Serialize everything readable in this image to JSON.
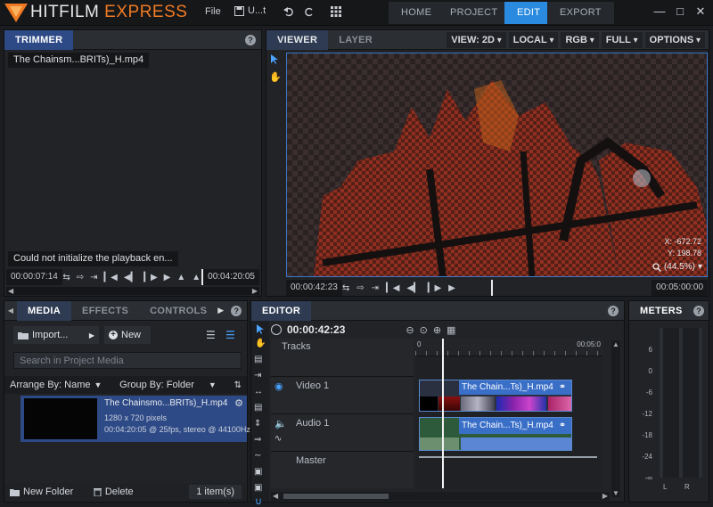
{
  "app": {
    "brand_main": "HITFILM",
    "brand_accent": "EXPRESS"
  },
  "menu": {
    "file": "File",
    "undo_label": "U...t"
  },
  "nav": {
    "tabs": [
      "HOME",
      "PROJECT",
      "EDIT",
      "EXPORT"
    ],
    "active": "EDIT"
  },
  "trimmer": {
    "tab": "TRIMMER",
    "file_label": "The Chainsm...BRITs)_H.mp4",
    "error_message": "Could not initialize the playback en...",
    "time_current": "00:00:07:14",
    "time_end": "00:04:20:05"
  },
  "viewer": {
    "tabs": [
      "VIEWER",
      "LAYER"
    ],
    "dropdowns": [
      "VIEW: 2D",
      "LOCAL",
      "RGB",
      "FULL",
      "OPTIONS"
    ],
    "coord_x_label": "X:",
    "coord_x": "-672.72",
    "coord_y_label": "Y:",
    "coord_y": "198.78",
    "zoom": "(44.5%)",
    "time_current": "00:00:42:23",
    "time_end": "00:05:00:00"
  },
  "media": {
    "tabs": [
      "MEDIA",
      "EFFECTS",
      "CONTROLS"
    ],
    "import_label": "Import...",
    "new_label": "New",
    "search_placeholder": "Search in Project Media",
    "arrange_label": "Arrange By: Name",
    "group_label": "Group By: Folder",
    "item": {
      "name": "The Chainsmo...BRITs)_H.mp4",
      "resolution": "1280 x 720 pixels",
      "details": "00:04:20:05 @ 25fps, stereo @ 44100Hz"
    },
    "new_folder_label": "New Folder",
    "delete_label": "Delete",
    "count": "1 item(s)"
  },
  "editor": {
    "tab": "EDITOR",
    "timecode": "00:00:42:23",
    "tracks_label": "Tracks",
    "ruler_start": "0",
    "ruler_mark": "00:05:0",
    "video_track": "Video 1",
    "audio_track": "Audio 1",
    "master_track": "Master",
    "video_clip_label": "The Chain...Ts)_H.mp4",
    "audio_clip_label": "The Chain...Ts)_H.mp4"
  },
  "meters": {
    "tab": "METERS",
    "scale": [
      "6",
      "0",
      "-6",
      "-12",
      "-18",
      "-24",
      "-∞"
    ],
    "channels": [
      "L",
      "R"
    ]
  },
  "colors": {
    "accent": "#2a8ae0",
    "brand_orange": "#f07a24",
    "selection": "#2e4a86",
    "clip_blue": "#3a6fc8"
  },
  "icons": [
    "logo-triangle-icon",
    "save-icon",
    "undo-icon",
    "redo-icon",
    "grid-icon",
    "minimize-icon",
    "maximize-icon",
    "close-icon",
    "select-arrow-icon",
    "hand-icon",
    "loop-icon",
    "play-icon",
    "gear-icon",
    "eye-icon",
    "speaker-icon",
    "magnet-icon",
    "search-icon",
    "folder-icon",
    "trash-icon"
  ]
}
